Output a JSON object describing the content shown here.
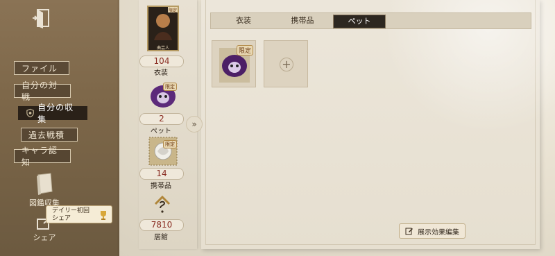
{
  "nav": {
    "file": "ファイル",
    "my_battles": "自分の対戦",
    "my_collection": "自分の収集",
    "past_records": "過去戦積",
    "character_awareness": "キャラ認知"
  },
  "side": {
    "codex_label": "図鑑収集",
    "share_label": "シェア",
    "daily_share": "デイリー初回シェア"
  },
  "tabs": [
    "衣装",
    "携帯品",
    "ペット"
  ],
  "active_tab": "ペット",
  "stats": {
    "costume": {
      "value": "104",
      "label": "衣装",
      "card_text": "曲芸人",
      "badge": "限定"
    },
    "pet": {
      "value": "2",
      "label": "ペット",
      "badge": "限定"
    },
    "accessory": {
      "value": "14",
      "label": "携帯品",
      "badge": "限定"
    },
    "residence": {
      "value": "7810",
      "label": "居館"
    }
  },
  "pet_slots": [
    {
      "filled": true,
      "badge": "限定"
    },
    {
      "filled": false
    }
  ],
  "edit_button": "展示効果編集",
  "colors": {
    "value_red": "#8a2d22",
    "active_tab_bg": "#2d2720"
  }
}
